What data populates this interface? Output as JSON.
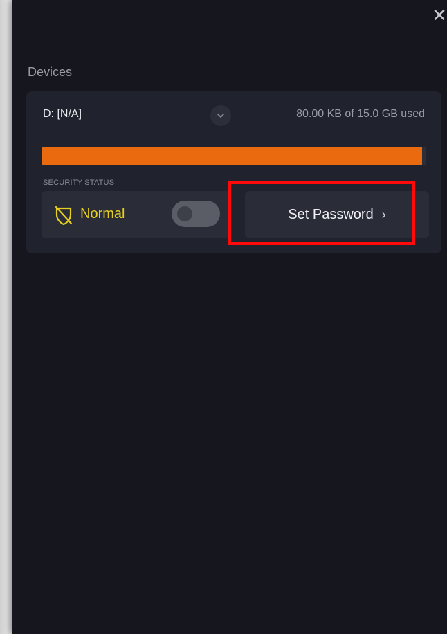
{
  "window": {
    "close_glyph": "✕"
  },
  "devices": {
    "section_title": "Devices",
    "drive": {
      "name": "D: [N/A]",
      "usage_text": "80.00 KB of 15.0 GB used",
      "usage_fraction": 0.99,
      "bar_color": "#e96a0f"
    },
    "security": {
      "label": "SECURITY STATUS",
      "status": "Normal",
      "status_color": "#e6cf1e",
      "toggle_on": false
    },
    "set_password": {
      "label": "Set Password",
      "chevron": "›"
    }
  },
  "annotation": {
    "highlight_color": "#ff0a0a"
  }
}
